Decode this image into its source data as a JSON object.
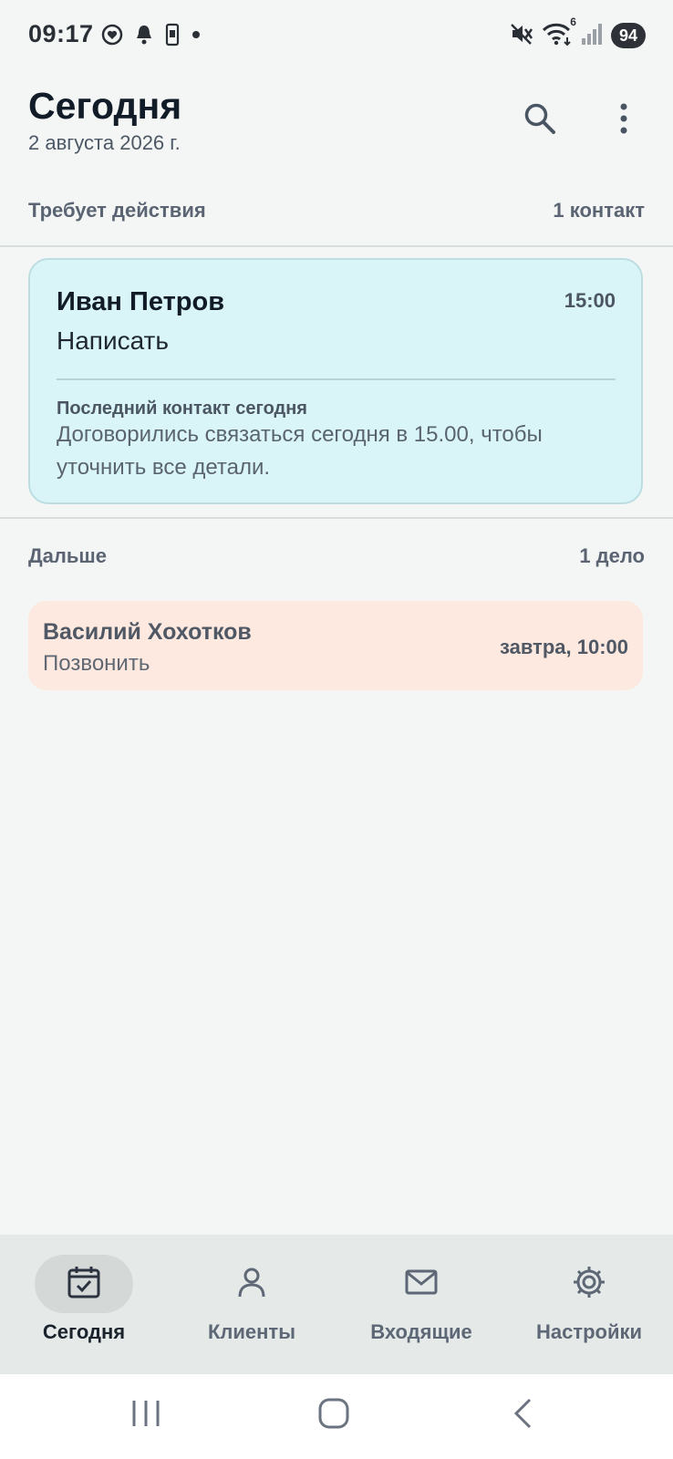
{
  "status_bar": {
    "time": "09:17",
    "battery": "94",
    "icons_left": [
      "heart-icon",
      "bell-icon",
      "phone-icon",
      "dot-icon"
    ],
    "icons_right": [
      "mute-icon",
      "wifi-icon",
      "signal-icon"
    ],
    "wifi_badge": "6"
  },
  "header": {
    "title": "Сегодня",
    "date": "2 августа 2026 г.",
    "icons": [
      "search-icon",
      "more-vert-icon"
    ]
  },
  "sections": {
    "action": {
      "label": "Требует действия",
      "count": "1 контакт"
    },
    "next": {
      "label": "Дальше",
      "count": "1 дело"
    }
  },
  "contact_card": {
    "name": "Иван Петров",
    "time": "15:00",
    "action": "Написать",
    "last_contact_label": "Последний контакт сегодня",
    "note": "Договорились связаться сегодня в 15.00, чтобы уточнить все детали."
  },
  "task_card": {
    "name": "Василий Хохотков",
    "action": "Позвонить",
    "when": "завтра, 10:00"
  },
  "bottom_nav": {
    "items": [
      {
        "label": "Сегодня",
        "icon": "calendar-check-icon",
        "active": true
      },
      {
        "label": "Клиенты",
        "icon": "person-icon",
        "active": false
      },
      {
        "label": "Входящие",
        "icon": "mail-icon",
        "active": false
      },
      {
        "label": "Настройки",
        "icon": "gear-icon",
        "active": false
      }
    ]
  },
  "colors": {
    "background": "#f4f6f5",
    "contact_card_bg": "#daf5f7",
    "task_card_bg": "#fde9df",
    "nav_bg": "#e5e9e8"
  }
}
